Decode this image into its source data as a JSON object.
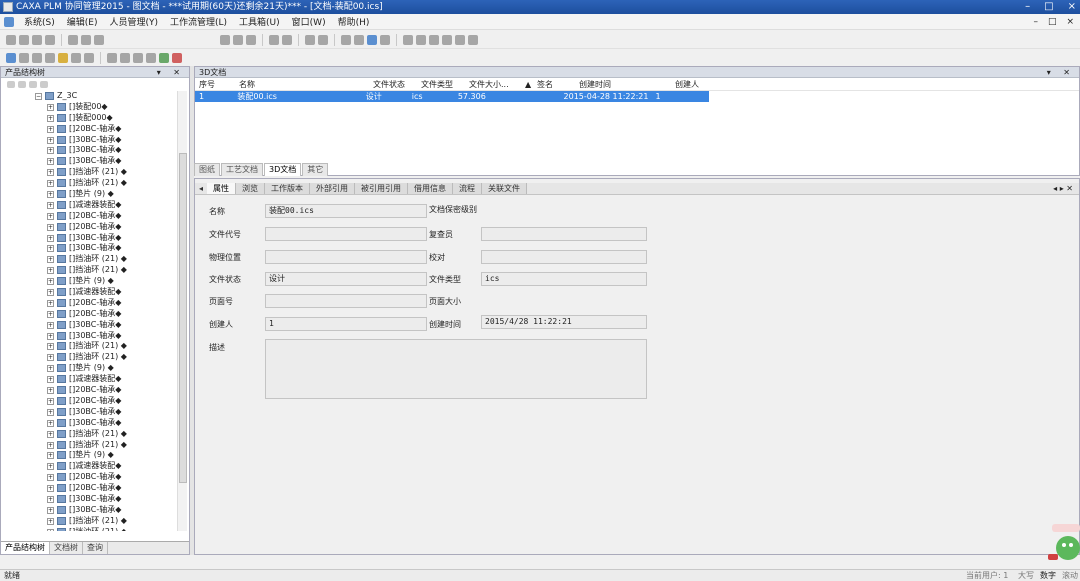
{
  "window": {
    "title": "CAXA PLM 协同管理2015 - 图文档 - ***试用期(60天)还剩余21天)*** - [文档-装配00.ics]",
    "controls": [
      "–",
      "□",
      "×"
    ]
  },
  "menu": {
    "items": [
      "系统(S)",
      "编辑(E)",
      "人员管理(Y)",
      "工作流管理(L)",
      "工具箱(U)",
      "窗口(W)",
      "帮助(H)"
    ],
    "mdi_controls": [
      "–",
      "□",
      "×"
    ]
  },
  "left_pane": {
    "title": "产品结构树",
    "controls": "▾ ✕",
    "tabs": [
      "产品结构树",
      "文档树",
      "查询"
    ],
    "tree": [
      {
        "label": "Z_3C",
        "level": 0,
        "icon": "folder"
      },
      {
        "label": "[]装配00◆",
        "level": 1
      },
      {
        "label": "[]装配000◆",
        "level": 1
      },
      {
        "label": "[]20BC-轴承◆",
        "level": 1
      },
      {
        "label": "[]30BC-轴承◆",
        "level": 1
      },
      {
        "label": "[]30BC-轴承◆",
        "level": 1
      },
      {
        "label": "[]30BC-轴承◆",
        "level": 1
      },
      {
        "label": "[]挡油环 (21) ◆",
        "level": 1
      },
      {
        "label": "[]挡油环 (21) ◆",
        "level": 1
      },
      {
        "label": "[]垫片 (9) ◆",
        "level": 1
      },
      {
        "label": "[]减速器装配◆",
        "level": 1
      },
      {
        "label": "[]20BC-轴承◆",
        "level": 1
      },
      {
        "label": "[]20BC-轴承◆",
        "level": 1
      },
      {
        "label": "[]30BC-轴承◆",
        "level": 1
      },
      {
        "label": "[]30BC-轴承◆",
        "level": 1
      },
      {
        "label": "[]挡油环 (21) ◆",
        "level": 1
      },
      {
        "label": "[]挡油环 (21) ◆",
        "level": 1
      },
      {
        "label": "[]垫片 (9) ◆",
        "level": 1
      },
      {
        "label": "[]减速器装配◆",
        "level": 1
      },
      {
        "label": "[]20BC-轴承◆",
        "level": 1
      },
      {
        "label": "[]20BC-轴承◆",
        "level": 1
      },
      {
        "label": "[]30BC-轴承◆",
        "level": 1
      },
      {
        "label": "[]30BC-轴承◆",
        "level": 1
      },
      {
        "label": "[]挡油环 (21) ◆",
        "level": 1
      },
      {
        "label": "[]挡油环 (21) ◆",
        "level": 1
      },
      {
        "label": "[]垫片 (9) ◆",
        "level": 1
      },
      {
        "label": "[]减速器装配◆",
        "level": 1
      },
      {
        "label": "[]20BC-轴承◆",
        "level": 1
      },
      {
        "label": "[]20BC-轴承◆",
        "level": 1
      },
      {
        "label": "[]30BC-轴承◆",
        "level": 1
      },
      {
        "label": "[]30BC-轴承◆",
        "level": 1
      },
      {
        "label": "[]挡油环 (21) ◆",
        "level": 1
      },
      {
        "label": "[]挡油环 (21) ◆",
        "level": 1
      },
      {
        "label": "[]垫片 (9) ◆",
        "level": 1
      },
      {
        "label": "[]减速器装配◆",
        "level": 1
      },
      {
        "label": "[]20BC-轴承◆",
        "level": 1
      },
      {
        "label": "[]20BC-轴承◆",
        "level": 1
      },
      {
        "label": "[]30BC-轴承◆",
        "level": 1
      },
      {
        "label": "[]30BC-轴承◆",
        "level": 1
      },
      {
        "label": "[]挡油环 (21) ◆",
        "level": 1
      },
      {
        "label": "[]挡油环 (21) ◆",
        "level": 1
      }
    ]
  },
  "doc_pane": {
    "title": "3D文档",
    "controls": "▾ ✕",
    "columns": [
      "序号",
      "名称",
      "文件状态",
      "文件类型",
      "文件大小...",
      "▲",
      "签名",
      "创建时间",
      "创建人"
    ],
    "rows": [
      [
        "1",
        "装配00.ics",
        "设计",
        "ics",
        "57.306",
        "",
        "",
        "2015-04-28 11:22:21",
        "1"
      ]
    ],
    "tabs": [
      "图纸",
      "工艺文档",
      "3D文档",
      "其它"
    ],
    "active_tab": 2
  },
  "prop_pane": {
    "nav_left": "◂",
    "nav_right": "◂ ▸ ✕",
    "tabs": [
      "属性",
      "浏览",
      "工作版本",
      "外部引用",
      "被引用引用",
      "借用信息",
      "流程",
      "关联文件"
    ],
    "active_tab": 0,
    "fields": {
      "name_label": "名称",
      "name_value": "装配00.ics",
      "secret_label": "文档保密级别",
      "code_label": "文件代号",
      "code_value": "",
      "reviewer_label": "复查员",
      "reviewer_value": "",
      "location_label": "物理位置",
      "location_value": "",
      "checker_label": "校对",
      "checker_value": "",
      "status_label": "文件状态",
      "status_value": "设计",
      "type_label": "文件类型",
      "type_value": "ics",
      "page_label": "页面号",
      "page_value": "",
      "pagesize_label": "页面大小",
      "creator_label": "创建人",
      "creator_value": "1",
      "ctime_label": "创建时间",
      "ctime_value": "2015/4/28 11:22:21",
      "desc_label": "描述",
      "desc_value": ""
    }
  },
  "status_bar": {
    "left": "就绪",
    "user_label": "当前用户: 1",
    "caps": "大写",
    "num": "数字",
    "scroll": "滚动"
  },
  "colors": {
    "title_bar": "#1f56a8",
    "selected_row": "#3a86e2"
  }
}
